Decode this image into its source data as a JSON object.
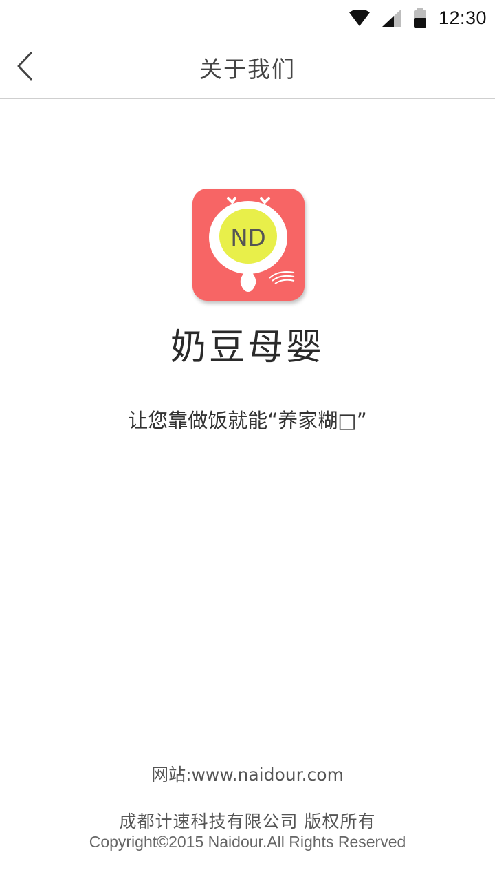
{
  "status_bar": {
    "time": "12:30",
    "icons": [
      "wifi-icon",
      "signal-icon",
      "battery-icon"
    ]
  },
  "header": {
    "title": "关于我们",
    "back_icon": "chevron-left-icon"
  },
  "app": {
    "logo_text": "ND",
    "name": "奶豆母婴",
    "slogan": "让您靠做饭就能“养家糊□”"
  },
  "footer": {
    "website": "网站:www.naidour.com",
    "company": "成都计速科技有限公司  版权所有",
    "copyright": "Copyright©2015 Naidour.All Rights Reserved"
  },
  "colors": {
    "logo_background": "#f76565",
    "logo_yellow": "#e8ef4a",
    "divider": "#cfcfcf"
  }
}
